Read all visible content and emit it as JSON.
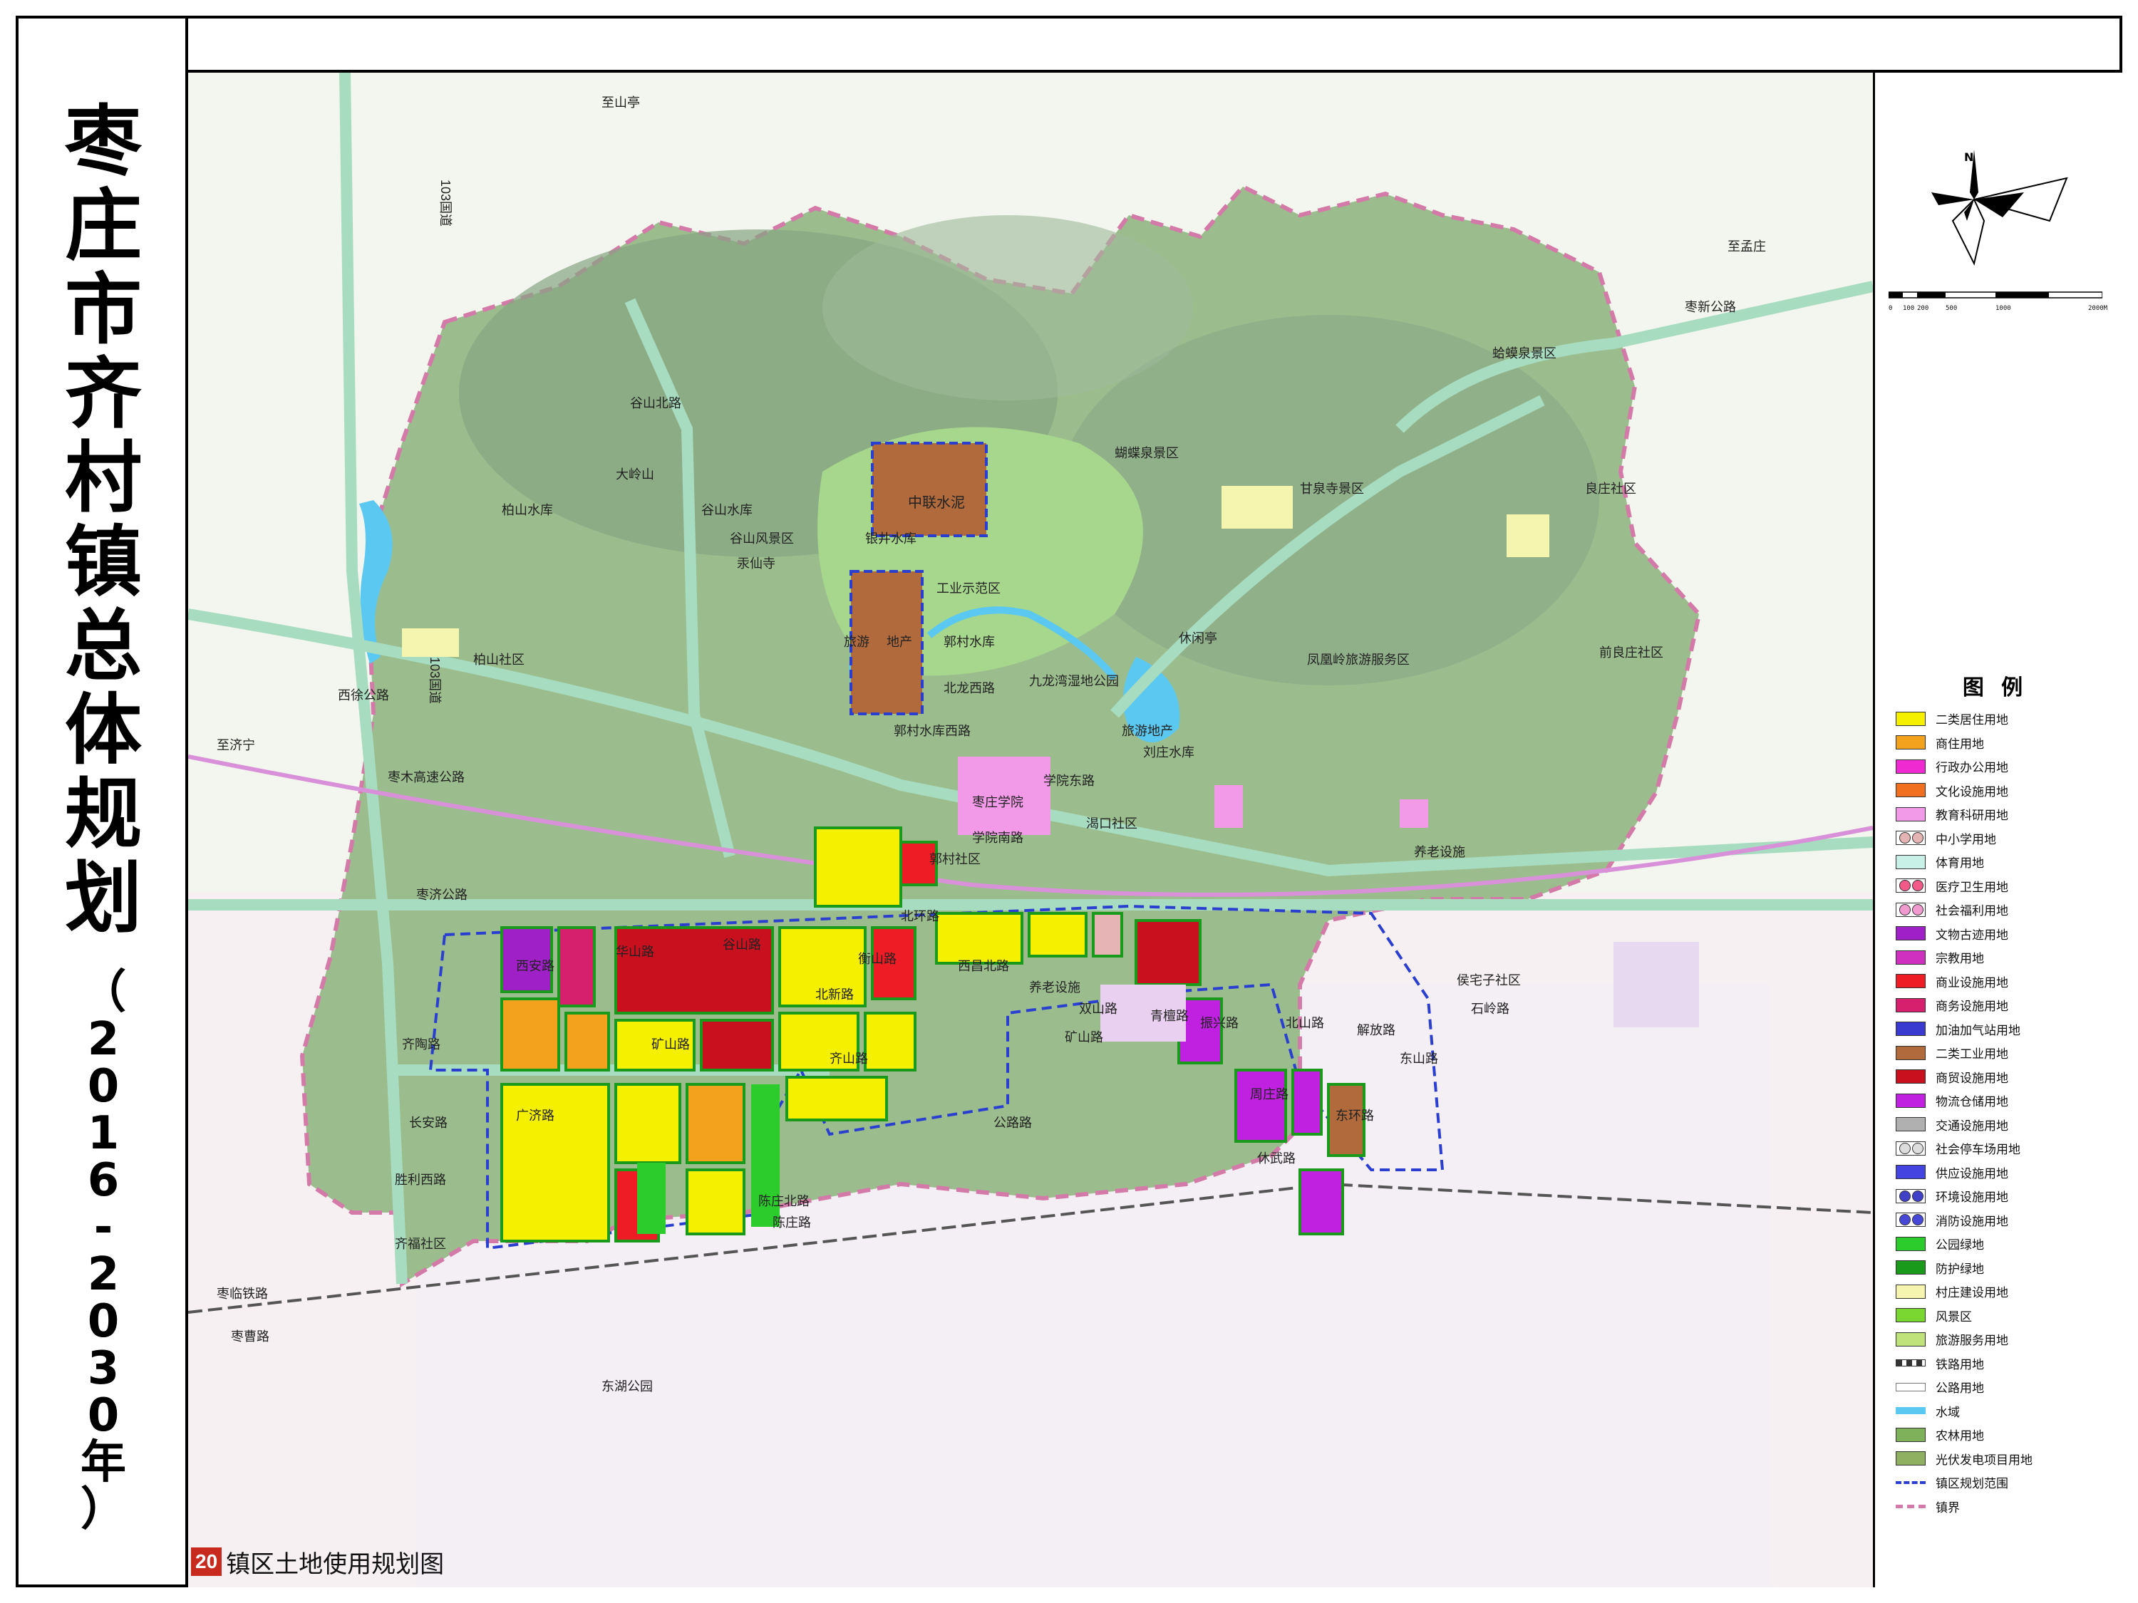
{
  "title": {
    "main": "枣庄市齐村镇总体规划",
    "years": "（2016-2030年）"
  },
  "caption": {
    "number": "20",
    "text": "镇区土地使用规划图"
  },
  "compass": {
    "north": "N"
  },
  "scale_bar": {
    "ticks": [
      "0",
      "100",
      "200",
      "500",
      "1000",
      "2000M"
    ]
  },
  "legend": {
    "title": "图 例",
    "items": [
      {
        "label": "二类居住用地",
        "color": "#f5f000",
        "kind": "fill"
      },
      {
        "label": "商住用地",
        "color": "#f2a21c",
        "kind": "fill"
      },
      {
        "label": "行政办公用地",
        "color": "#ee2ad0",
        "kind": "fill"
      },
      {
        "label": "文化设施用地",
        "color": "#f07020",
        "kind": "fill"
      },
      {
        "label": "教育科研用地",
        "color": "#f29ae8",
        "kind": "fill"
      },
      {
        "label": "中小学用地",
        "color": "#e6b4b4",
        "kind": "symbol"
      },
      {
        "label": "体育用地",
        "color": "#c8f0e6",
        "kind": "fill"
      },
      {
        "label": "医疗卫生用地",
        "color": "#f35a8a",
        "kind": "symbol"
      },
      {
        "label": "社会福利用地",
        "color": "#f09ad0",
        "kind": "symbol"
      },
      {
        "label": "文物古迹用地",
        "color": "#a020c8",
        "kind": "fill"
      },
      {
        "label": "宗教用地",
        "color": "#d030c0",
        "kind": "fill"
      },
      {
        "label": "商业设施用地",
        "color": "#ee1c24",
        "kind": "fill"
      },
      {
        "label": "商务设施用地",
        "color": "#d6206e",
        "kind": "fill"
      },
      {
        "label": "加油加气站用地",
        "color": "#3a3ad0",
        "kind": "fill"
      },
      {
        "label": "二类工业用地",
        "color": "#b06a3c",
        "kind": "fill"
      },
      {
        "label": "商贸设施用地",
        "color": "#c8101e",
        "kind": "fill"
      },
      {
        "label": "物流仓储用地",
        "color": "#c020e0",
        "kind": "fill"
      },
      {
        "label": "交通设施用地",
        "color": "#b0b0b0",
        "kind": "fill"
      },
      {
        "label": "社会停车场用地",
        "color": "#dddddd",
        "kind": "symbol"
      },
      {
        "label": "供应设施用地",
        "color": "#4444e0",
        "kind": "fill"
      },
      {
        "label": "环境设施用地",
        "color": "#4040c8",
        "kind": "symbol"
      },
      {
        "label": "消防设施用地",
        "color": "#4848d8",
        "kind": "symbol"
      },
      {
        "label": "公园绿地",
        "color": "#2ccc2c",
        "kind": "fill"
      },
      {
        "label": "防护绿地",
        "color": "#1a9a1a",
        "kind": "fill"
      },
      {
        "label": "村庄建设用地",
        "color": "#f5f5b0",
        "kind": "fill"
      },
      {
        "label": "风景区",
        "color": "#7ad630",
        "kind": "fill"
      },
      {
        "label": "旅游服务用地",
        "color": "#bfe27a",
        "kind": "fill"
      },
      {
        "label": "铁路用地",
        "color": "#555555",
        "kind": "rail"
      },
      {
        "label": "公路用地",
        "color": "#888888",
        "kind": "road"
      },
      {
        "label": "水域",
        "color": "#5ac8f0",
        "kind": "water"
      },
      {
        "label": "农林用地",
        "color": "#7fb05a",
        "kind": "fill"
      },
      {
        "label": "光伏发电项目用地",
        "color": "#8fb060",
        "kind": "fill"
      },
      {
        "label": "镇区规划范围",
        "color": "#2a3fd0",
        "kind": "dash"
      },
      {
        "label": "镇界",
        "color": "#d47aa8",
        "kind": "bound"
      }
    ]
  },
  "map_labels": {
    "zhishanting": "至山亭",
    "g103a": "103国道",
    "g103b": "103国道",
    "zhiwuzhuang": "至孟庄",
    "zaoxin": "枣新公路",
    "hamajinquan": "蛤蟆泉景区",
    "guyubeilu": "谷山北路",
    "dalingshan": "大岭山",
    "baishanshuiku": "柏山水库",
    "gushanshuiku": "谷山水库",
    "gushanfengjing": "谷山风景区",
    "xianxianfeng": "汞仙寺",
    "zhonglian": "中联水泥",
    "yinjingshuiku": "银井水库",
    "gongyeshifan": "工业示范区",
    "lvyou": "旅游",
    "dichan": "地产",
    "guocunshuiku": "郭村水库",
    "jiulongwan": "九龙湾湿地公园",
    "hudiequan": "蝴蝶泉景区",
    "ganquansi": "甘泉寺景区",
    "liangzhuang": "良庄社区",
    "xiuxianting": "休闲亭",
    "fenghuangling": "凤凰岭旅游服务区",
    "qianliangzhuang": "前良庄社区",
    "baishanshequ": "柏山社区",
    "xixulu": "西徐公路",
    "guocunxilu": "郭村水库西路",
    "beilongxilu": "北龙西路",
    "zaozhuangxueyuan": "枣庄学院",
    "xueyuandonglu": "学院东路",
    "xueyuannanlu": "学院南路",
    "lvyoudichan": "旅游地产",
    "liuzhuangshuiku": "刘庄水库",
    "zhijining": "至济宁",
    "zaomugaosu": "枣木高速公路",
    "guocunshequ": "郭村社区",
    "yangke": "渴口社区",
    "yanglao": "养老设施",
    "zaojilu": "枣济公路",
    "xianlu": "西安路",
    "gushanlu": "谷山路",
    "hengshanlu": "衡山路",
    "beihuanlu": "北环路",
    "xichangbeilu": "西昌北路",
    "huashanlu": "华山路",
    "yanglaosheshi": "养老设施",
    "beixinlu": "北新路",
    "shuangshanlu": "双山路",
    "qingtanlu": "青檀路",
    "zhenxinglu": "振兴路",
    "beishanlu": "北山路",
    "jiefanglu": "解放路",
    "dongshanlu": "东山路",
    "houzhaizi": "侯宅子社区",
    "shilinglu": "石岭路",
    "kuangshanlu": "矿山路",
    "kuangshanlu2": "矿山路",
    "qitaolu": "齐陶路",
    "guangjilu": "广济路",
    "changanlu": "长安路",
    "qishanlu": "齐山路",
    "gonglulu": "公路路",
    "zhouzhuanglu": "周庄路",
    "donghuanlu": "东环路",
    "xiuwulu": "休武路",
    "shenglixilu": "胜利西路",
    "chenzhuangbeilu": "陈庄北路",
    "chenzhuanglu": "陈庄路",
    "qifushequ": "齐福社区",
    "zaolintielu": "枣临铁路",
    "zaocaolu": "枣曹路",
    "donghugongyuan": "东湖公园"
  }
}
